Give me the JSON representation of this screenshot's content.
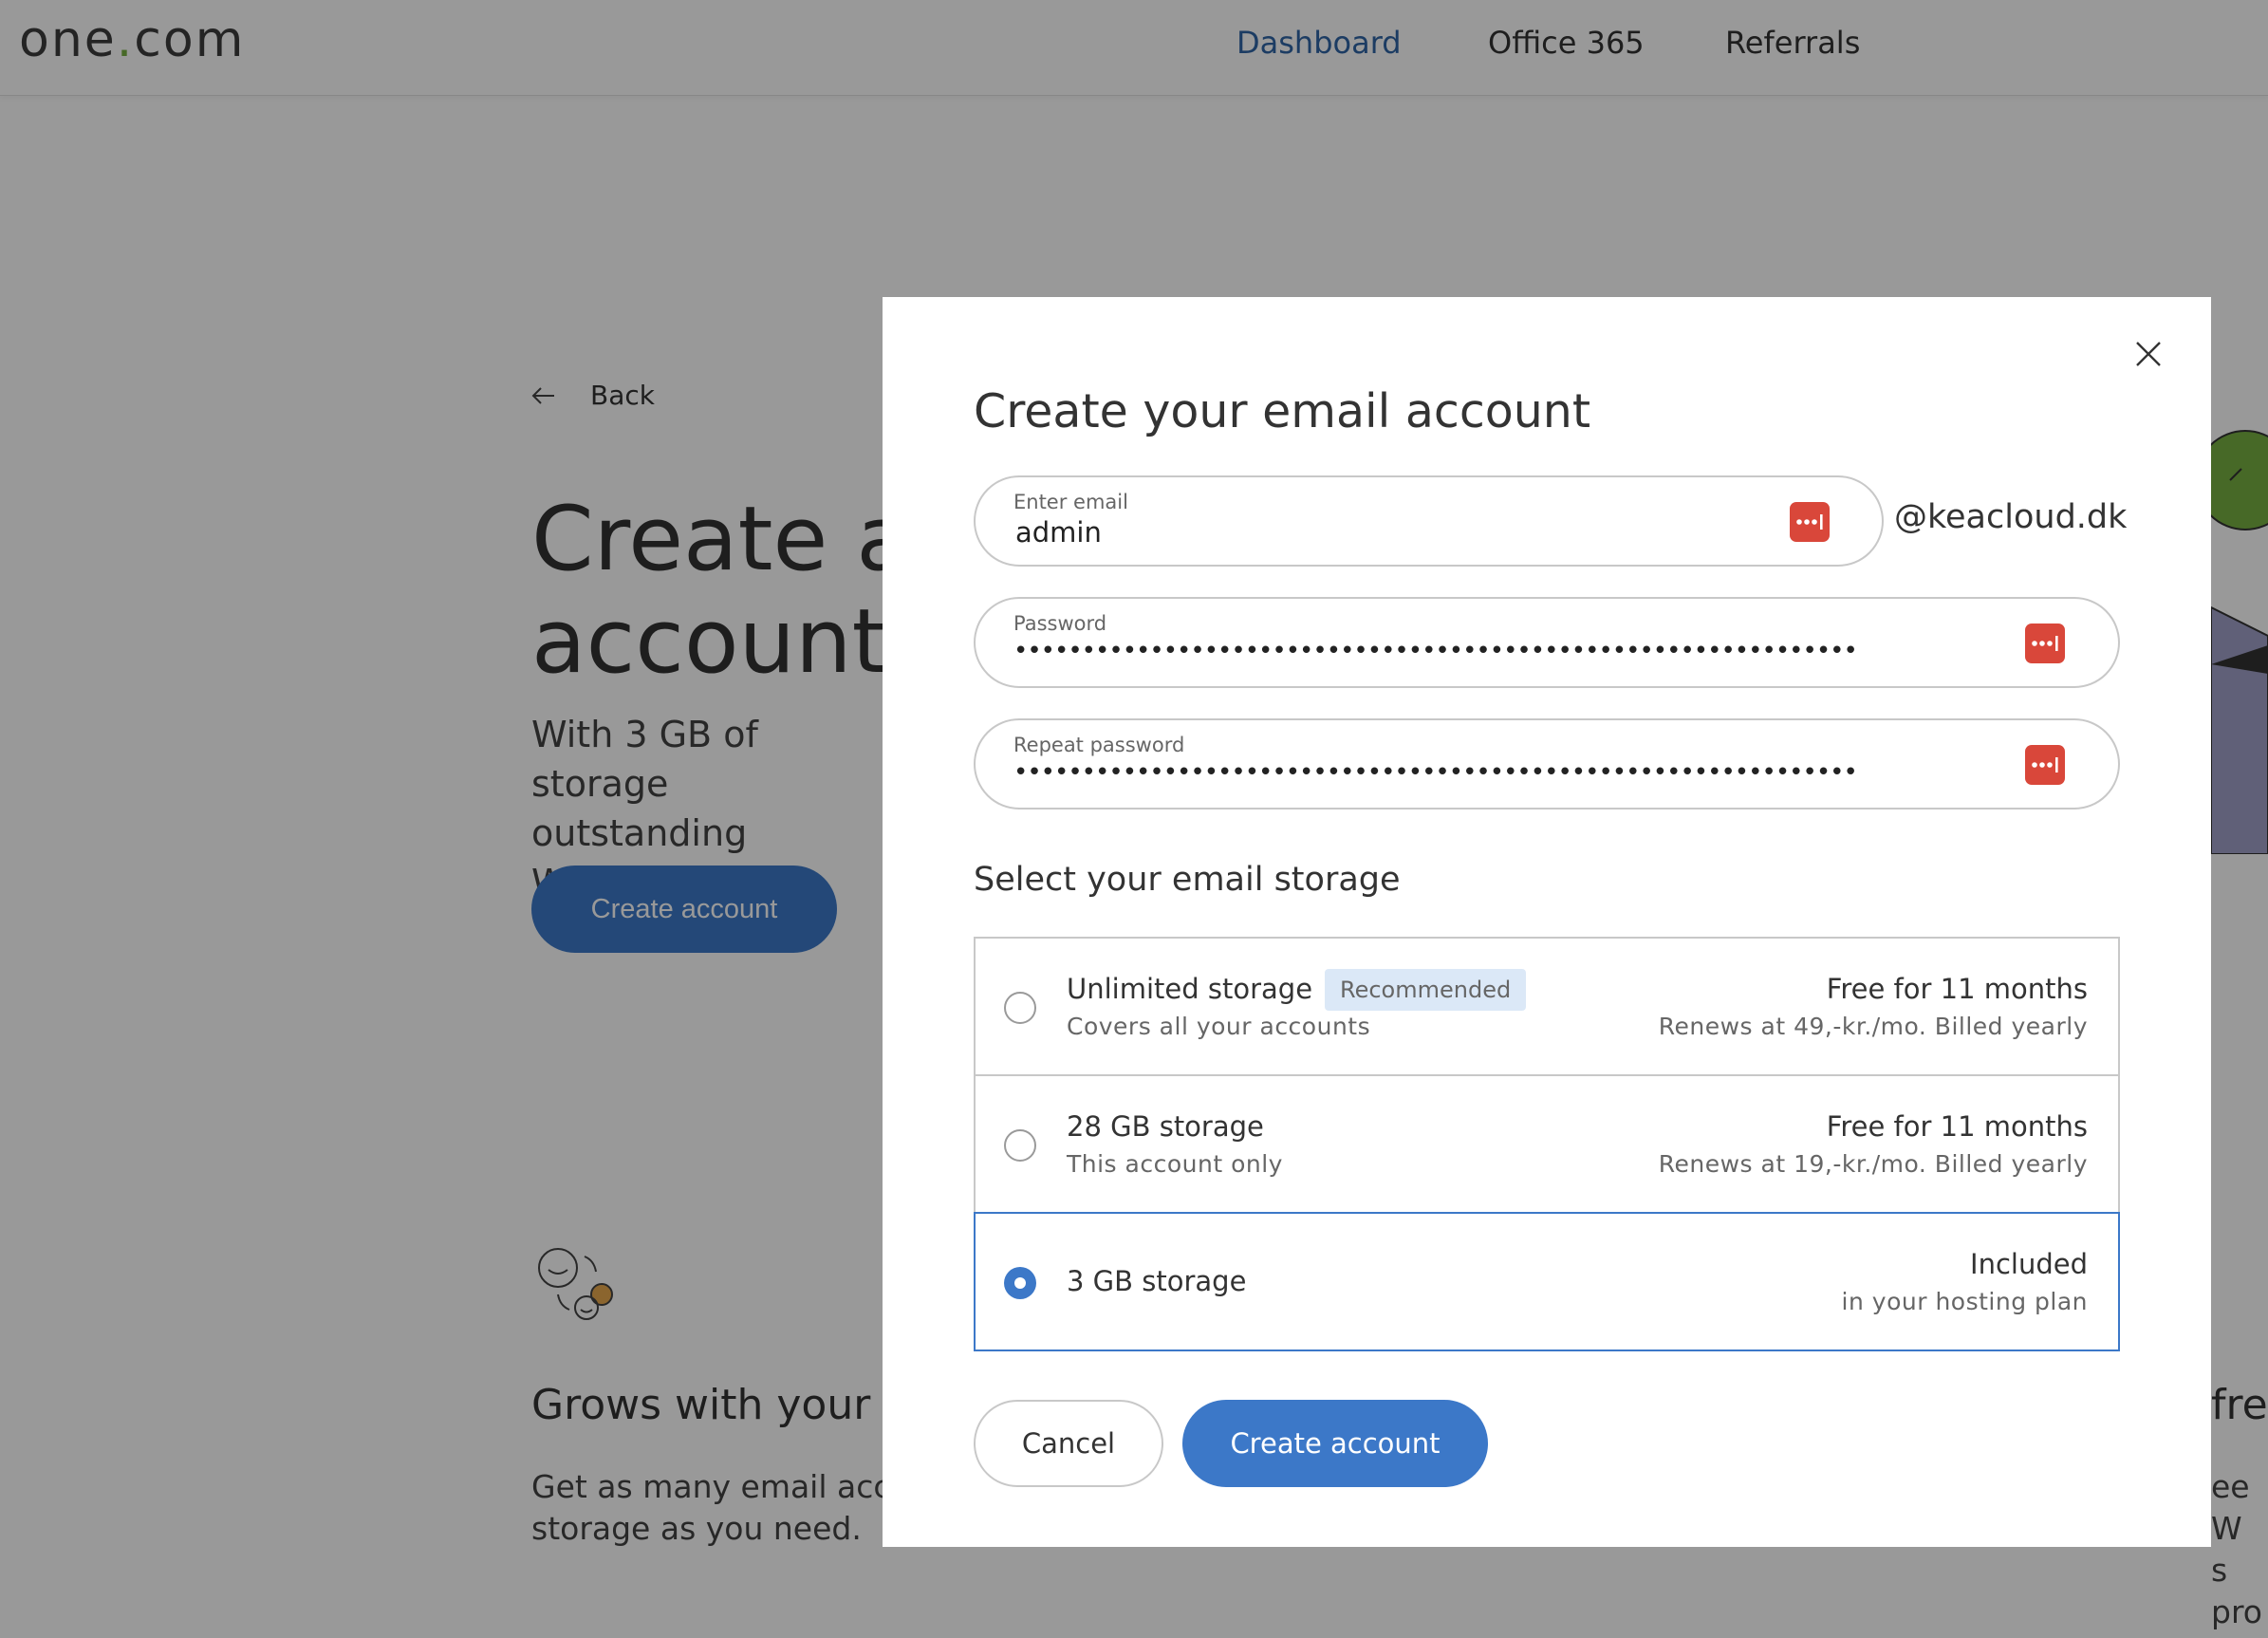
{
  "nav": {
    "logo_main": "one",
    "logo_dot": ".",
    "logo_tld": "com",
    "links": [
      "Dashboard",
      "Office 365",
      "Referrals"
    ]
  },
  "background": {
    "back_label": "Back",
    "heading_line1": "Create a",
    "heading_line2": "account",
    "subtitle_line1": "With 3 GB of storage",
    "subtitle_line2": "outstanding Webma",
    "create_button": "Create account",
    "feature_title": "Grows with your",
    "feature_text_line1": "Get as many email acc",
    "feature_text_line2": "storage as you need.",
    "right_title": "fre",
    "right_text_line1": "ee W",
    "right_text_line2": "s pro"
  },
  "modal": {
    "title": "Create your email account",
    "email": {
      "label": "Enter email",
      "value": "admin",
      "domain": "@keacloud.dk"
    },
    "password": {
      "label": "Password",
      "masked": "••••••••••••••••••••••••••••••••••••••••••••••••••••••••••••••"
    },
    "repeat_password": {
      "label": "Repeat password",
      "masked": "••••••••••••••••••••••••••••••••••••••••••••••••••••••••••••••"
    },
    "storage_title": "Select your email storage",
    "options": [
      {
        "name": "Unlimited storage",
        "badge": "Recommended",
        "desc": "Covers all your accounts",
        "price": "Free for 11 months",
        "renew": "Renews at 49,-kr./mo. Billed yearly",
        "selected": false
      },
      {
        "name": "28 GB storage",
        "desc": "This account only",
        "price": "Free for 11 months",
        "renew": "Renews at 19,-kr./mo. Billed yearly",
        "selected": false
      },
      {
        "name": "3 GB storage",
        "price": "Included",
        "renew": "in your hosting plan",
        "selected": true
      }
    ],
    "cancel_label": "Cancel",
    "create_label": "Create account"
  },
  "colors": {
    "accent": "#3c78c8",
    "nav_active": "#2f65a6",
    "badge_bg": "#dbe8f7",
    "password_manager_icon": "#d9473a",
    "logo_dot": "#77b041"
  }
}
